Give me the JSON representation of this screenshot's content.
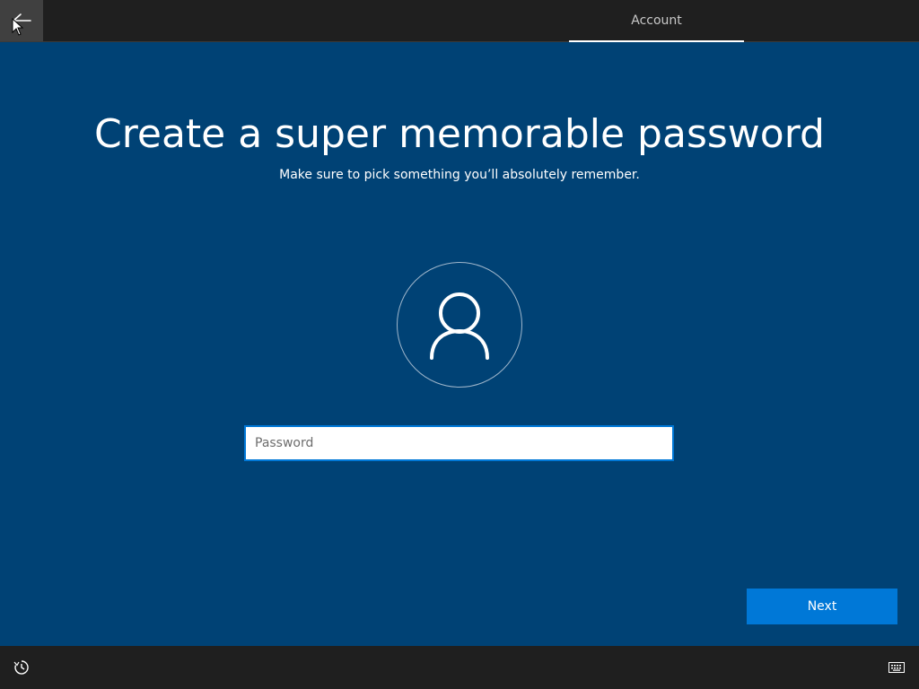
{
  "header": {
    "back_icon": "arrow-left-icon",
    "tab_label": "Account"
  },
  "main": {
    "title": "Create a super memorable password",
    "subtitle": "Make sure to pick something you’ll absolutely remember.",
    "avatar_icon": "user-icon",
    "password": {
      "value": "",
      "placeholder": "Password"
    },
    "next_label": "Next"
  },
  "footer": {
    "left_icon": "ease-of-access-icon",
    "right_icon": "keyboard-icon"
  },
  "colors": {
    "background": "#004275",
    "bar": "#1f1f1f",
    "accent": "#0078d7"
  }
}
